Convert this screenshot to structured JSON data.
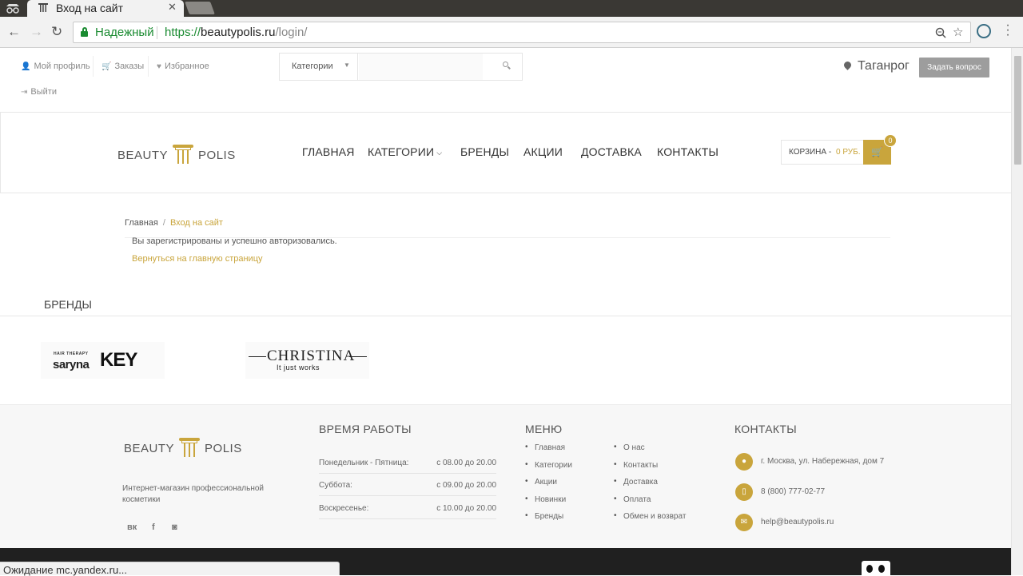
{
  "browser": {
    "tab_title": "Вход на сайт",
    "secure_label": "Надежный",
    "url_scheme": "https://",
    "url_host": "beautypolis.ru",
    "url_path": "/login/",
    "status_text": "Ожидание mc.yandex.ru..."
  },
  "topbar": {
    "profile": "Мой профиль",
    "orders": "Заказы",
    "favorites": "Избранное",
    "logout": "Выйти",
    "search_category": "Категории",
    "search_placeholder": "",
    "city": "Таганрог",
    "ask_button": "Задать вопрос"
  },
  "logo": {
    "left": "BEAUTY",
    "right": "POLIS"
  },
  "nav": {
    "home": "ГЛАВНАЯ",
    "categories": "КАТЕГОРИИ",
    "brands": "БРЕНДЫ",
    "promos": "АКЦИИ",
    "delivery": "ДОСТАВКА",
    "contacts": "КОНТАКТЫ"
  },
  "cart": {
    "label": "КОРЗИНА -",
    "price": "0 РУБ.",
    "count": "0"
  },
  "breadcrumb": {
    "home": "Главная",
    "separator": "/",
    "current": "Вход на сайт"
  },
  "content": {
    "message": "Вы зарегистрированы и успешно авторизовались.",
    "back_link": "Вернуться на главную страницу"
  },
  "brands": {
    "title": "БРЕНДЫ",
    "key_small": "HAIR THERAPY",
    "key_saryna": "saryna",
    "key_key": "KEY",
    "key_tm": "TM",
    "christina_name": "CHRISTINA",
    "christina_tag": "It just works"
  },
  "footer": {
    "description": "Интернет-магазин профессиональной косметики",
    "social": {
      "vk": "вк",
      "fb": "f",
      "ig": "◙"
    },
    "hours_title": "ВРЕМЯ РАБОТЫ",
    "hours": [
      {
        "day": "Понедельник - Пятница:",
        "time": "с 08.00 до 20.00"
      },
      {
        "day": "Суббота:",
        "time": "с 09.00 до 20.00"
      },
      {
        "day": "Воскресенье:",
        "time": "с 10.00 до 20.00"
      }
    ],
    "menu_title": "МЕНЮ",
    "menu_col1": [
      "Главная",
      "Категории",
      "Акции",
      "Новинки",
      "Бренды"
    ],
    "menu_col2": [
      "О нас",
      "Контакты",
      "Доставка",
      "Оплата",
      "Обмен и возврат"
    ],
    "contacts_title": "КОНТАКТЫ",
    "address": "г. Москва, ул. Набережная, дом 7",
    "phone": "8 (800) 777-02-77",
    "email": "help@beautypolis.ru"
  },
  "colors": {
    "accent": "#c9a53c",
    "secure": "#1a8b31",
    "footer_dark": "#202020"
  }
}
